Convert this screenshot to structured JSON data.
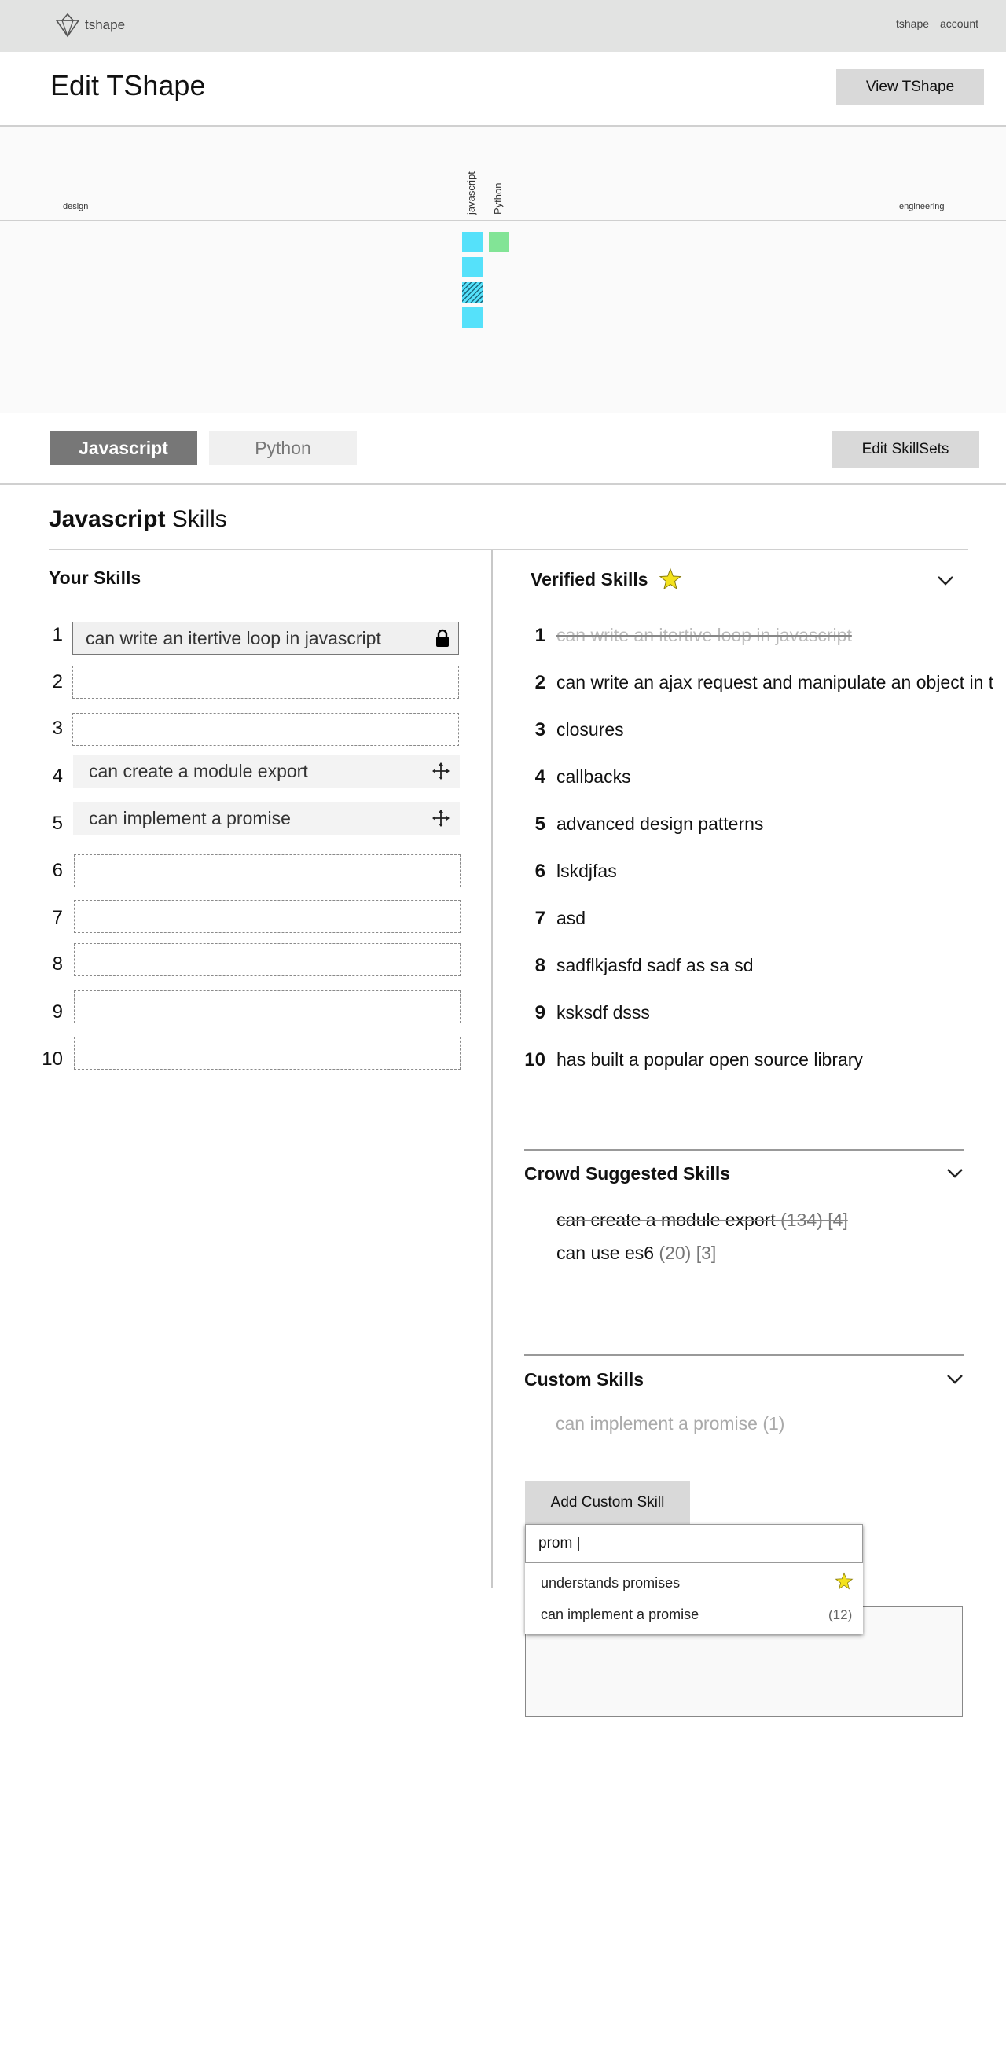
{
  "nav": {
    "brand": "tshape",
    "links": [
      "tshape",
      "account"
    ]
  },
  "header": {
    "title": "Edit TShape",
    "view_button": "View TShape"
  },
  "tshape": {
    "left_label": "design",
    "right_label": "engineering",
    "columns": [
      {
        "label": "javascript",
        "cells": [
          "filled",
          "filled",
          "hatched",
          "filled"
        ],
        "color": "#55e1fa"
      },
      {
        "label": "Python",
        "cells": [
          "filled"
        ],
        "color": "#82e496"
      }
    ]
  },
  "tabs": {
    "items": [
      "Javascript",
      "Python"
    ],
    "active": "Javascript",
    "edit_button": "Edit SkillSets"
  },
  "section": {
    "title_bold": "Javascript",
    "title_rest": " Skills"
  },
  "your_skills": {
    "heading": "Your Skills",
    "slots": [
      {
        "n": "1",
        "text": "can write an itertive loop in javascript",
        "state": "locked"
      },
      {
        "n": "2",
        "text": "",
        "state": "empty"
      },
      {
        "n": "3",
        "text": "",
        "state": "empty"
      },
      {
        "n": "4",
        "text": "can create a module export",
        "state": "filled"
      },
      {
        "n": "5",
        "text": "can implement a promise",
        "state": "filled"
      },
      {
        "n": "6",
        "text": "",
        "state": "empty"
      },
      {
        "n": "7",
        "text": "",
        "state": "empty"
      },
      {
        "n": "8",
        "text": "",
        "state": "empty"
      },
      {
        "n": "9",
        "text": "",
        "state": "empty"
      },
      {
        "n": "10",
        "text": "",
        "state": "empty"
      }
    ]
  },
  "verified": {
    "heading": "Verified Skills",
    "items": [
      {
        "n": "1",
        "text": "can write an itertive loop in javascript",
        "struck": true
      },
      {
        "n": "2",
        "text": "can write an ajax request and manipulate an object in t"
      },
      {
        "n": "3",
        "text": "closures"
      },
      {
        "n": "4",
        "text": "callbacks"
      },
      {
        "n": "5",
        "text": "advanced design patterns"
      },
      {
        "n": "6",
        "text": "lskdjfas"
      },
      {
        "n": "7",
        "text": "asd"
      },
      {
        "n": "8",
        "text": "sadflkjasfd sadf as sa sd"
      },
      {
        "n": "9",
        "text": "ksksdf dsss"
      },
      {
        "n": "10",
        "text": "has built a popular open source library"
      }
    ]
  },
  "crowd": {
    "heading": "Crowd Suggested Skills",
    "items": [
      {
        "text": "can create a module export",
        "counts": "(134) [4]",
        "struck": true
      },
      {
        "text": "can use es6",
        "counts": "(20) [3]"
      }
    ]
  },
  "custom": {
    "heading": "Custom Skills",
    "items": [
      "can implement a promise (1)"
    ],
    "add_button": "Add Custom Skill",
    "input_value": "prom |",
    "suggestions": [
      {
        "text": "understands promises",
        "badge": "star"
      },
      {
        "text": "can implement a promise",
        "badge": "(12)"
      }
    ]
  },
  "colors": {
    "accent_cyan": "#55e1fa",
    "accent_green": "#82e496",
    "star": "#f4e21d"
  }
}
